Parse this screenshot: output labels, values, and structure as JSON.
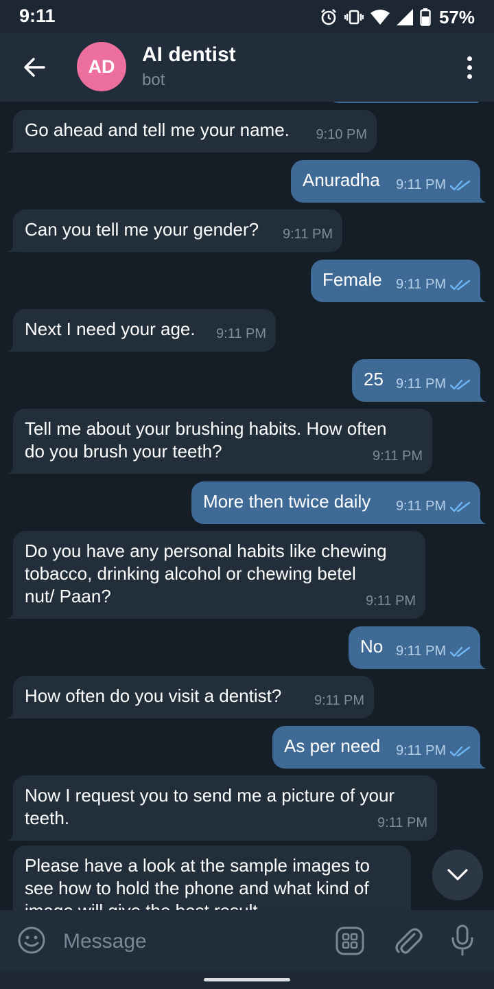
{
  "status_bar": {
    "time": "9:11",
    "battery": "57%"
  },
  "header": {
    "avatar_initials": "AD",
    "title": "AI dentist",
    "subtitle": "bot"
  },
  "messages": [
    {
      "dir": "in",
      "lines": [
        "Go ahead and tell me your name."
      ],
      "time": "9:10 PM"
    },
    {
      "dir": "out",
      "lines": [
        "Anuradha"
      ],
      "time": "9:11 PM"
    },
    {
      "dir": "in",
      "lines": [
        "Can you tell me your gender?"
      ],
      "time": "9:11 PM"
    },
    {
      "dir": "out",
      "lines": [
        "Female"
      ],
      "time": "9:11 PM"
    },
    {
      "dir": "in",
      "lines": [
        "Next I need your age."
      ],
      "time": "9:11 PM"
    },
    {
      "dir": "out",
      "lines": [
        "25"
      ],
      "time": "9:11 PM"
    },
    {
      "dir": "in",
      "lines": [
        "Tell me about your brushing habits. How often",
        "do you brush your teeth?"
      ],
      "time": "9:11 PM"
    },
    {
      "dir": "out",
      "lines": [
        "More then twice daily"
      ],
      "time": "9:11 PM"
    },
    {
      "dir": "in",
      "lines": [
        "Do you have any personal habits like chewing",
        "tobacco, drinking alcohol or chewing betel",
        "nut/ Paan?"
      ],
      "time": "9:11 PM"
    },
    {
      "dir": "out",
      "lines": [
        "No"
      ],
      "time": "9:11 PM"
    },
    {
      "dir": "in",
      "lines": [
        "How often do you visit a dentist?"
      ],
      "time": "9:11 PM"
    },
    {
      "dir": "out",
      "lines": [
        "As per need"
      ],
      "time": "9:11 PM"
    },
    {
      "dir": "in",
      "lines": [
        "Now I request you to send me a picture of your",
        "teeth."
      ],
      "time": "9:11 PM"
    },
    {
      "dir": "in",
      "lines": [
        "Please have a look at the sample images to",
        "see how to hold the phone and what kind of",
        "image will give the best result"
      ],
      "time": ""
    }
  ],
  "composer": {
    "placeholder": "Message"
  },
  "colors": {
    "incoming": "#222e3a",
    "outgoing": "#3f6a96",
    "background": "#151e27",
    "header": "#212d3b",
    "avatar": "#ec6f9e",
    "ticks": "#6fb6f5"
  }
}
